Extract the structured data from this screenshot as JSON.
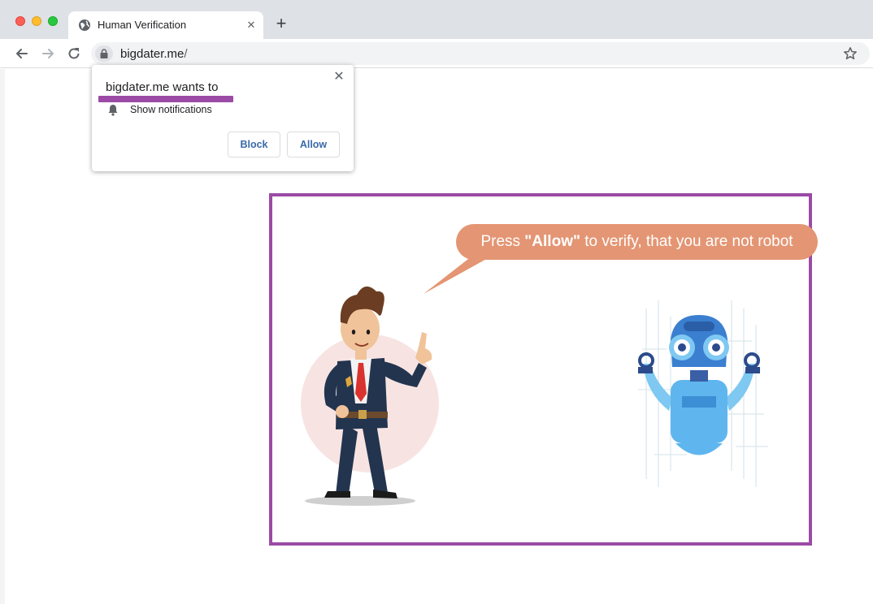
{
  "browser": {
    "tab_title": "Human Verification",
    "new_tab_label": "+",
    "tab_close_label": "✕",
    "url_host": "bigdater.me",
    "url_path": "/"
  },
  "permission_prompt": {
    "title": "bigdater.me wants to",
    "permission": "Show notifications",
    "close_label": "✕",
    "block_label": "Block",
    "allow_label": "Allow"
  },
  "page": {
    "bubble_prefix": "Press ",
    "bubble_bold": "\"Allow\"",
    "bubble_suffix": " to verify, that you are not robot"
  },
  "colors": {
    "frame_border": "#9b4ba5",
    "bubble": "#e49573",
    "highlight": "#9b4ba5"
  },
  "icons": {
    "tab": "globe-icon",
    "back": "back-arrow-icon",
    "forward": "forward-arrow-icon",
    "reload": "reload-icon",
    "lock": "lock-icon",
    "bookmark": "star-icon",
    "permission": "bell-icon"
  }
}
